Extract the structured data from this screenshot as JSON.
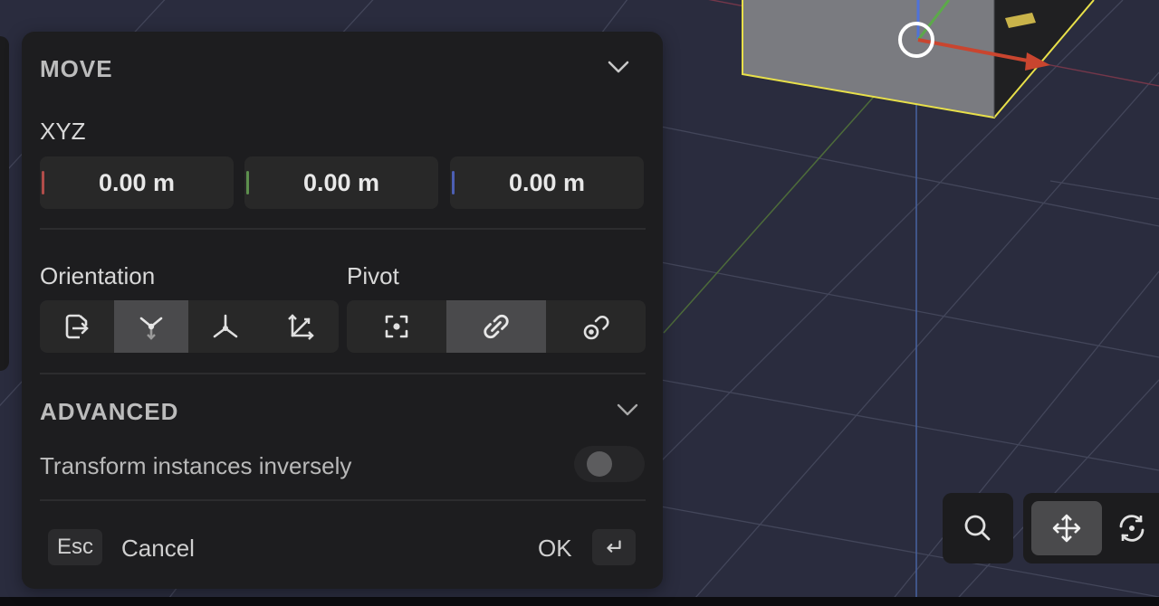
{
  "move_panel": {
    "title": "MOVE",
    "xyz_label": "XYZ",
    "x_value": "0.00 m",
    "y_value": "0.00 m",
    "z_value": "0.00 m",
    "axis_colors": {
      "x": "#b14d4a",
      "y": "#5d8f4e",
      "z": "#4c5fb3"
    },
    "orientation_label": "Orientation",
    "pivot_label": "Pivot",
    "orientation_buttons": [
      {
        "icon": "export-arrow-icon",
        "active": false
      },
      {
        "icon": "normal-axes-icon",
        "active": true
      },
      {
        "icon": "global-axes-icon",
        "active": false
      },
      {
        "icon": "local-axes-icon",
        "active": false
      }
    ],
    "pivot_buttons": [
      {
        "icon": "center-target-icon",
        "active": false
      },
      {
        "icon": "link-icon",
        "active": true
      },
      {
        "icon": "linked-pivot-icon",
        "active": false
      }
    ],
    "advanced_title": "ADVANCED",
    "transform_inverse_label": "Transform instances inversely",
    "transform_inverse_enabled": false,
    "esc_key": "Esc",
    "cancel_label": "Cancel",
    "ok_label": "OK",
    "enter_key_icon": "enter-key-icon"
  },
  "toolbar": {
    "items": [
      {
        "icon": "search-icon",
        "active": false
      },
      {
        "icon": "move-icon",
        "active": true
      },
      {
        "icon": "rotate-icon",
        "active": false
      }
    ]
  },
  "colors": {
    "panel_bg": "#1d1d1f",
    "viewport_bg": "#2a2c3e",
    "selection_outline": "#e8e04a",
    "active_segment": "#4a4a4c"
  }
}
